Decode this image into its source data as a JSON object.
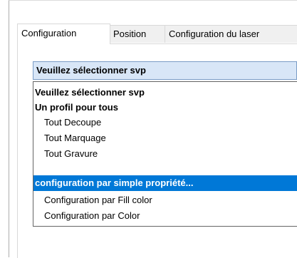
{
  "tabs": [
    {
      "label": "Configuration",
      "active": true
    },
    {
      "label": "Position",
      "active": false
    },
    {
      "label": "Configuration du laser",
      "active": false
    }
  ],
  "profile_select": {
    "selected_value": "Veuillez sélectionner svp"
  },
  "dropdown_options": [
    {
      "label": "Veuillez sélectionner svp",
      "kind": "group"
    },
    {
      "label": "Un profil pour tous",
      "kind": "group"
    },
    {
      "label": "Tout Decoupe",
      "kind": "item"
    },
    {
      "label": "Tout Marquage",
      "kind": "item"
    },
    {
      "label": "Tout Gravure",
      "kind": "item"
    },
    {
      "label": "configuration par simple propriété...",
      "kind": "group",
      "highlighted": true
    },
    {
      "label": "Configuration par Fill color",
      "kind": "item"
    },
    {
      "label": "Configuration par Color",
      "kind": "item"
    }
  ],
  "colors": {
    "highlight": "#0078d7",
    "combo_background": "#d8e6f7"
  }
}
